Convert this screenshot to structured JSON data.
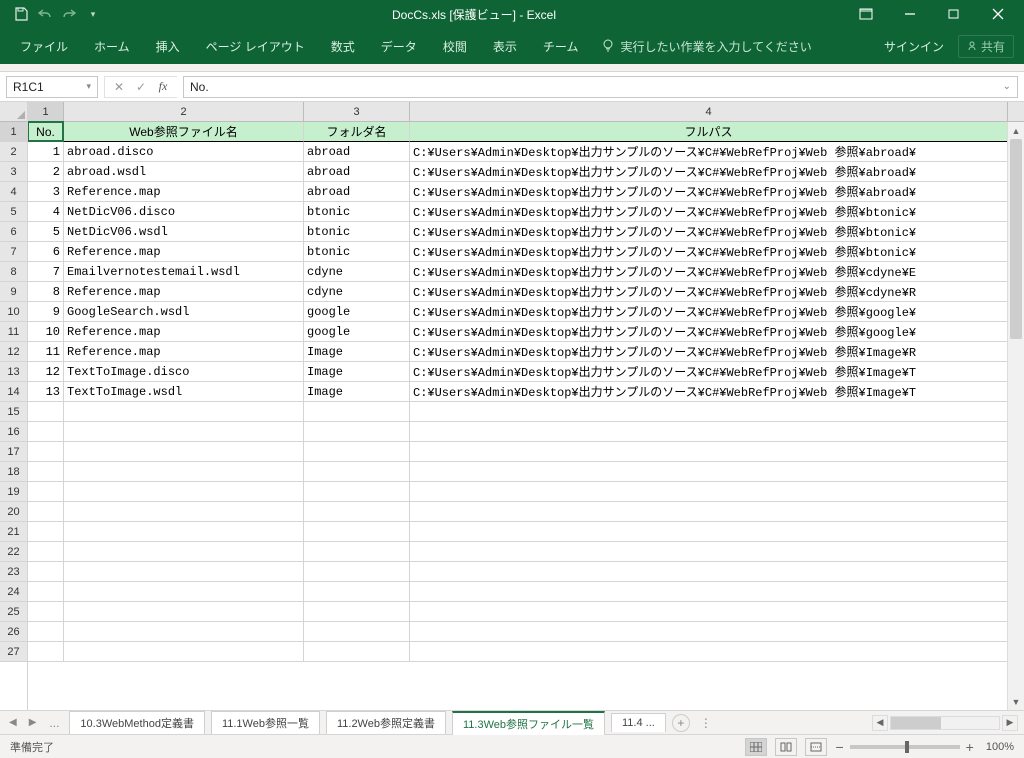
{
  "titlebar": {
    "title": "DocCs.xls  [保護ビュー] - Excel"
  },
  "ribbon": {
    "tabs": [
      "ファイル",
      "ホーム",
      "挿入",
      "ページ レイアウト",
      "数式",
      "データ",
      "校閲",
      "表示",
      "チーム"
    ],
    "tell": "実行したい作業を入力してください",
    "signin": "サインイン",
    "share": "共有"
  },
  "formula": {
    "namebox": "R1C1",
    "input": "No."
  },
  "columns": [
    "1",
    "2",
    "3",
    "4"
  ],
  "header_row": [
    "No.",
    "Web参照ファイル名",
    "フォルダ名",
    "フルパス"
  ],
  "rows": [
    {
      "n": "1",
      "file": "abroad.disco",
      "folder": "abroad",
      "path": "C:¥Users¥Admin¥Desktop¥出力サンプルのソース¥C#¥WebRefProj¥Web 参照¥abroad¥"
    },
    {
      "n": "2",
      "file": "abroad.wsdl",
      "folder": "abroad",
      "path": "C:¥Users¥Admin¥Desktop¥出力サンプルのソース¥C#¥WebRefProj¥Web 参照¥abroad¥"
    },
    {
      "n": "3",
      "file": "Reference.map",
      "folder": "abroad",
      "path": "C:¥Users¥Admin¥Desktop¥出力サンプルのソース¥C#¥WebRefProj¥Web 参照¥abroad¥"
    },
    {
      "n": "4",
      "file": "NetDicV06.disco",
      "folder": "btonic",
      "path": "C:¥Users¥Admin¥Desktop¥出力サンプルのソース¥C#¥WebRefProj¥Web 参照¥btonic¥"
    },
    {
      "n": "5",
      "file": "NetDicV06.wsdl",
      "folder": "btonic",
      "path": "C:¥Users¥Admin¥Desktop¥出力サンプルのソース¥C#¥WebRefProj¥Web 参照¥btonic¥"
    },
    {
      "n": "6",
      "file": "Reference.map",
      "folder": "btonic",
      "path": "C:¥Users¥Admin¥Desktop¥出力サンプルのソース¥C#¥WebRefProj¥Web 参照¥btonic¥"
    },
    {
      "n": "7",
      "file": "Emailvernotestemail.wsdl",
      "folder": "cdyne",
      "path": "C:¥Users¥Admin¥Desktop¥出力サンプルのソース¥C#¥WebRefProj¥Web 参照¥cdyne¥E"
    },
    {
      "n": "8",
      "file": "Reference.map",
      "folder": "cdyne",
      "path": "C:¥Users¥Admin¥Desktop¥出力サンプルのソース¥C#¥WebRefProj¥Web 参照¥cdyne¥R"
    },
    {
      "n": "9",
      "file": "GoogleSearch.wsdl",
      "folder": "google",
      "path": "C:¥Users¥Admin¥Desktop¥出力サンプルのソース¥C#¥WebRefProj¥Web 参照¥google¥"
    },
    {
      "n": "10",
      "file": "Reference.map",
      "folder": "google",
      "path": "C:¥Users¥Admin¥Desktop¥出力サンプルのソース¥C#¥WebRefProj¥Web 参照¥google¥"
    },
    {
      "n": "11",
      "file": "Reference.map",
      "folder": "Image",
      "path": "C:¥Users¥Admin¥Desktop¥出力サンプルのソース¥C#¥WebRefProj¥Web 参照¥Image¥R"
    },
    {
      "n": "12",
      "file": "TextToImage.disco",
      "folder": "Image",
      "path": "C:¥Users¥Admin¥Desktop¥出力サンプルのソース¥C#¥WebRefProj¥Web 参照¥Image¥T"
    },
    {
      "n": "13",
      "file": "TextToImage.wsdl",
      "folder": "Image",
      "path": "C:¥Users¥Admin¥Desktop¥出力サンプルのソース¥C#¥WebRefProj¥Web 参照¥Image¥T"
    }
  ],
  "row_numbers": [
    "1",
    "2",
    "3",
    "4",
    "5",
    "6",
    "7",
    "8",
    "9",
    "10",
    "11",
    "12",
    "13",
    "14",
    "15",
    "16",
    "17",
    "18",
    "19",
    "20",
    "21",
    "22",
    "23",
    "24",
    "25",
    "26",
    "27"
  ],
  "sheet_tabs": {
    "left_more": "...",
    "tabs": [
      "10.3WebMethod定義書",
      "11.1Web参照一覧",
      "11.2Web参照定義書",
      "11.3Web参照ファイル一覧",
      "11.4 ..."
    ],
    "active_index": 3
  },
  "status": {
    "ready": "準備完了",
    "zoom": "100%"
  }
}
